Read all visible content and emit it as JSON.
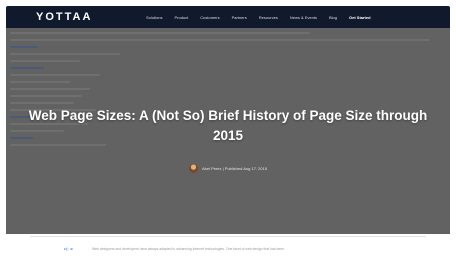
{
  "brand": {
    "logo": "YOTTAA"
  },
  "nav": {
    "items": [
      "Solutions",
      "Product",
      "Customers",
      "Partners",
      "Resources",
      "News & Events",
      "Blog"
    ],
    "cta": "Get Started"
  },
  "hero": {
    "title": "Web Page Sizes: A (Not So) Brief History of Page Size through 2015",
    "byline": "Abel Perez | Published Aug 17, 2015"
  },
  "article": {
    "intro": "Web designers and developers have always adapted to advancing Internet technologies. One facet of web design that has been"
  },
  "icons": {
    "share": "share-icon",
    "author_avatar": "avatar"
  },
  "colors": {
    "navbar": "#101a2c",
    "hero_overlay": "#6b6b6b",
    "share_icon": "#2b7bd6"
  }
}
